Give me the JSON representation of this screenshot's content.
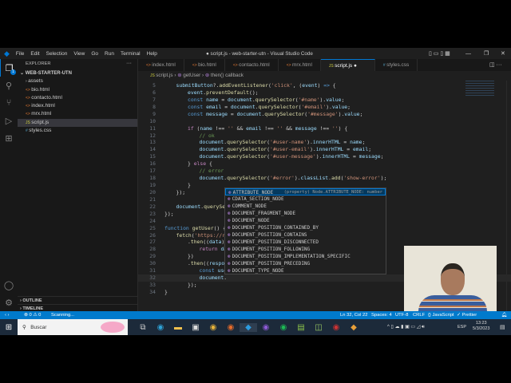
{
  "window": {
    "title": "● script.js - web-starter-utn - Visual Studio Code",
    "menu": [
      "File",
      "Edit",
      "Selection",
      "View",
      "Go",
      "Run",
      "Terminal",
      "Help"
    ]
  },
  "activity_bar": {
    "badge": "1"
  },
  "explorer": {
    "header": "EXPLORER",
    "root": "WEB-STARTER-UTN",
    "items": [
      {
        "label": "assets",
        "icon": "folder-chevron"
      },
      {
        "label": "bio.html",
        "icon": "html"
      },
      {
        "label": "contacto.html",
        "icon": "html"
      },
      {
        "label": "index.html",
        "icon": "html"
      },
      {
        "label": "mrx.html",
        "icon": "html"
      },
      {
        "label": "script.js",
        "icon": "js",
        "selected": true
      },
      {
        "label": "styles.css",
        "icon": "css"
      }
    ],
    "outline": "OUTLINE",
    "timeline": "TIMELINE"
  },
  "tabs": [
    {
      "label": "index.html",
      "icon": "html"
    },
    {
      "label": "bio.html",
      "icon": "html"
    },
    {
      "label": "contacto.html",
      "icon": "html"
    },
    {
      "label": "mrx.html",
      "icon": "html"
    },
    {
      "label": "script.js",
      "icon": "js",
      "active": true,
      "modified": true
    },
    {
      "label": "styles.css",
      "icon": "css"
    }
  ],
  "breadcrumb": [
    "script.js",
    "getUser",
    "then() callback"
  ],
  "code_lines": [
    {
      "n": "5",
      "i": 1,
      "t": [
        [
          "vr",
          "submitButton"
        ],
        [
          "pl",
          "?."
        ],
        [
          "fn",
          "addEventListener"
        ],
        [
          "pl",
          "("
        ],
        [
          "st",
          "'click'"
        ],
        [
          "pl",
          ", ("
        ],
        [
          "vr",
          "event"
        ],
        [
          "pl",
          ") "
        ],
        [
          "kw",
          "=>"
        ],
        [
          "pl",
          " {"
        ]
      ]
    },
    {
      "n": "6",
      "i": 2,
      "t": [
        [
          "vr",
          "event"
        ],
        [
          "pl",
          "."
        ],
        [
          "fn",
          "preventDefault"
        ],
        [
          "pl",
          "();"
        ]
      ]
    },
    {
      "n": "7",
      "i": 2,
      "t": [
        [
          "kw",
          "const "
        ],
        [
          "vr",
          "name"
        ],
        [
          "pl",
          " = "
        ],
        [
          "vr",
          "document"
        ],
        [
          "pl",
          "."
        ],
        [
          "fn",
          "querySelector"
        ],
        [
          "pl",
          "("
        ],
        [
          "st",
          "'#name'"
        ],
        [
          "pl",
          ")."
        ],
        [
          "vr",
          "value"
        ],
        [
          "pl",
          ";"
        ]
      ]
    },
    {
      "n": "8",
      "i": 2,
      "t": [
        [
          "kw",
          "const "
        ],
        [
          "vr",
          "email"
        ],
        [
          "pl",
          " = "
        ],
        [
          "vr",
          "document"
        ],
        [
          "pl",
          "."
        ],
        [
          "fn",
          "querySelector"
        ],
        [
          "pl",
          "("
        ],
        [
          "st",
          "'#email'"
        ],
        [
          "pl",
          ")."
        ],
        [
          "vr",
          "value"
        ],
        [
          "pl",
          ";"
        ]
      ]
    },
    {
      "n": "9",
      "i": 2,
      "t": [
        [
          "kw",
          "const "
        ],
        [
          "vr",
          "message"
        ],
        [
          "pl",
          " = "
        ],
        [
          "vr",
          "document"
        ],
        [
          "pl",
          "."
        ],
        [
          "fn",
          "querySelector"
        ],
        [
          "pl",
          "("
        ],
        [
          "st",
          "'#message'"
        ],
        [
          "pl",
          ")."
        ],
        [
          "vr",
          "value"
        ],
        [
          "pl",
          ";"
        ]
      ]
    },
    {
      "n": "10",
      "i": 0,
      "t": []
    },
    {
      "n": "11",
      "i": 2,
      "t": [
        [
          "kc",
          "if"
        ],
        [
          "pl",
          " ("
        ],
        [
          "vr",
          "name"
        ],
        [
          "pl",
          " !== "
        ],
        [
          "st",
          "''"
        ],
        [
          "pl",
          " && "
        ],
        [
          "vr",
          "email"
        ],
        [
          "pl",
          " !== "
        ],
        [
          "st",
          "''"
        ],
        [
          "pl",
          " && "
        ],
        [
          "vr",
          "message"
        ],
        [
          "pl",
          " !== "
        ],
        [
          "st",
          "''"
        ],
        [
          "pl",
          ") {"
        ]
      ]
    },
    {
      "n": "12",
      "i": 3,
      "t": [
        [
          "cm",
          "// ok"
        ]
      ]
    },
    {
      "n": "13",
      "i": 3,
      "t": [
        [
          "vr",
          "document"
        ],
        [
          "pl",
          "."
        ],
        [
          "fn",
          "querySelector"
        ],
        [
          "pl",
          "("
        ],
        [
          "st",
          "'#user-name'"
        ],
        [
          "pl",
          ")."
        ],
        [
          "vr",
          "innerHTML"
        ],
        [
          "pl",
          " = "
        ],
        [
          "vr",
          "name"
        ],
        [
          "pl",
          ";"
        ]
      ]
    },
    {
      "n": "14",
      "i": 3,
      "t": [
        [
          "vr",
          "document"
        ],
        [
          "pl",
          "."
        ],
        [
          "fn",
          "querySelector"
        ],
        [
          "pl",
          "("
        ],
        [
          "st",
          "'#user-email'"
        ],
        [
          "pl",
          ")."
        ],
        [
          "vr",
          "innerHTML"
        ],
        [
          "pl",
          " = "
        ],
        [
          "vr",
          "email"
        ],
        [
          "pl",
          ";"
        ]
      ]
    },
    {
      "n": "15",
      "i": 3,
      "t": [
        [
          "vr",
          "document"
        ],
        [
          "pl",
          "."
        ],
        [
          "fn",
          "querySelector"
        ],
        [
          "pl",
          "("
        ],
        [
          "st",
          "'#user-message'"
        ],
        [
          "pl",
          ")."
        ],
        [
          "vr",
          "innerHTML"
        ],
        [
          "pl",
          " = "
        ],
        [
          "vr",
          "message"
        ],
        [
          "pl",
          ";"
        ]
      ]
    },
    {
      "n": "16",
      "i": 2,
      "t": [
        [
          "pl",
          "} "
        ],
        [
          "kc",
          "else"
        ],
        [
          "pl",
          " {"
        ]
      ]
    },
    {
      "n": "17",
      "i": 3,
      "t": [
        [
          "cm",
          "// error"
        ]
      ]
    },
    {
      "n": "18",
      "i": 3,
      "t": [
        [
          "vr",
          "document"
        ],
        [
          "pl",
          "."
        ],
        [
          "fn",
          "querySelector"
        ],
        [
          "pl",
          "("
        ],
        [
          "st",
          "'#error'"
        ],
        [
          "pl",
          ")."
        ],
        [
          "vr",
          "classList"
        ],
        [
          "pl",
          "."
        ],
        [
          "fn",
          "add"
        ],
        [
          "pl",
          "("
        ],
        [
          "st",
          "'show-error'"
        ],
        [
          "pl",
          ");"
        ]
      ]
    },
    {
      "n": "19",
      "i": 2,
      "t": [
        [
          "pl",
          "}"
        ]
      ]
    },
    {
      "n": "20",
      "i": 1,
      "t": [
        [
          "pl",
          "});"
        ]
      ]
    },
    {
      "n": "21",
      "i": 0,
      "t": []
    },
    {
      "n": "22",
      "i": 1,
      "t": [
        [
          "vr",
          "document"
        ],
        [
          "pl",
          "."
        ],
        [
          "fn",
          "querySel"
        ]
      ]
    },
    {
      "n": "23",
      "i": 0,
      "t": [
        [
          "pl",
          "});"
        ]
      ]
    },
    {
      "n": "24",
      "i": 0,
      "t": []
    },
    {
      "n": "25",
      "i": 0,
      "t": [
        [
          "kw",
          "function "
        ],
        [
          "fn",
          "getUser"
        ],
        [
          "pl",
          "() {"
        ]
      ]
    },
    {
      "n": "26",
      "i": 1,
      "t": [
        [
          "fn",
          "fetch"
        ],
        [
          "pl",
          "("
        ],
        [
          "st",
          "'https://ra"
        ]
      ]
    },
    {
      "n": "27",
      "i": 2,
      "t": [
        [
          "pl",
          "."
        ],
        [
          "fn",
          "then"
        ],
        [
          "pl",
          "(("
        ],
        [
          "vr",
          "data"
        ],
        [
          "pl",
          ") "
        ]
      ]
    },
    {
      "n": "28",
      "i": 3,
      "t": [
        [
          "kc",
          "return "
        ],
        [
          "vr",
          "da"
        ]
      ]
    },
    {
      "n": "29",
      "i": 2,
      "t": [
        [
          "pl",
          "})"
        ]
      ]
    },
    {
      "n": "30",
      "i": 2,
      "t": [
        [
          "pl",
          "."
        ],
        [
          "fn",
          "then"
        ],
        [
          "pl",
          "(("
        ],
        [
          "vr",
          "respon"
        ]
      ]
    },
    {
      "n": "31",
      "i": 3,
      "t": [
        [
          "kw",
          "const "
        ],
        [
          "vr",
          "use"
        ]
      ]
    },
    {
      "n": "32",
      "i": 3,
      "t": [
        [
          "vr",
          "document"
        ],
        [
          "pl",
          "."
        ]
      ]
    },
    {
      "n": "33",
      "i": 2,
      "t": [
        [
          "pl",
          "});"
        ]
      ]
    },
    {
      "n": "34",
      "i": 0,
      "t": [
        [
          "pl",
          "}"
        ]
      ]
    }
  ],
  "suggestions": {
    "items": [
      "ATTRIBUTE_NODE",
      "CDATA_SECTION_NODE",
      "COMMENT_NODE",
      "DOCUMENT_FRAGMENT_NODE",
      "DOCUMENT_NODE",
      "DOCUMENT_POSITION_CONTAINED_BY",
      "DOCUMENT_POSITION_CONTAINS",
      "DOCUMENT_POSITION_DISCONNECTED",
      "DOCUMENT_POSITION_FOLLOWING",
      "DOCUMENT_POSITION_IMPLEMENTATION_SPECIFIC",
      "DOCUMENT_POSITION_PRECEDING",
      "DOCUMENT_TYPE_NODE"
    ],
    "detail": "(property) Node.ATTRIBUTE_NODE: number"
  },
  "statusbar": {
    "errors": "⊗ 0",
    "warnings": "⚠ 0",
    "scanning": "Scanning...",
    "position": "Ln 32, Col 22",
    "spaces": "Spaces: 4",
    "encoding": "UTF-8",
    "eol": "CRLF",
    "language": "{} JavaScript",
    "prettier": "✓ Prettier"
  },
  "taskbar": {
    "search_placeholder": "Buscar",
    "time": "13:23",
    "date": "5/3/2023",
    "lang": "ESP"
  }
}
